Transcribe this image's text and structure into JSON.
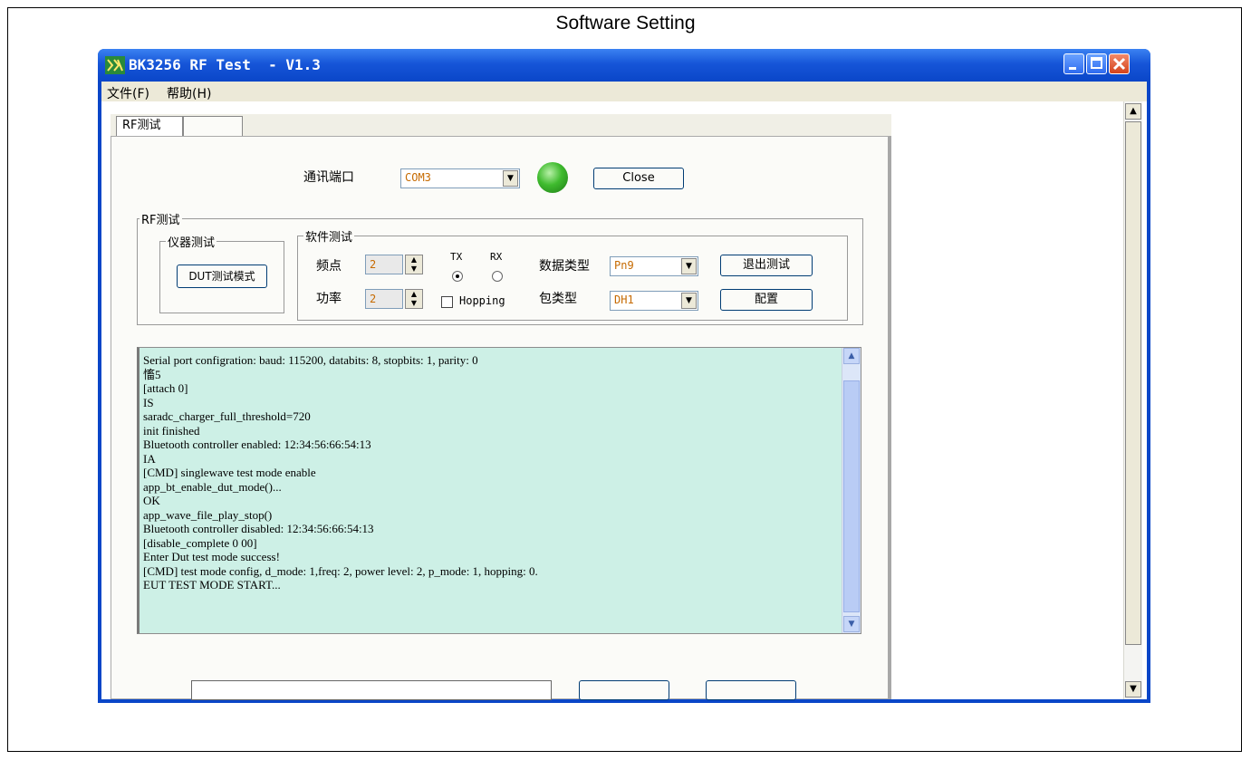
{
  "page": {
    "title": "Software Setting"
  },
  "window": {
    "title": "BK3256 RF Test  - V1.3",
    "menu": [
      "文件(F)",
      "帮助(H)"
    ]
  },
  "tabs": [
    {
      "label": "RF测试"
    },
    {
      "label": ""
    }
  ],
  "connection": {
    "port_label": "通讯端口",
    "port_value": "COM3",
    "status_color": "#3fbb2e",
    "close_label": "Close"
  },
  "rf_group": {
    "label": "RF测试",
    "instrument": {
      "label": "仪器测试",
      "dut_button": "DUT测试模式"
    },
    "software": {
      "label": "软件测试",
      "freq_label": "频点",
      "freq_value": "2",
      "power_label": "功率",
      "power_value": "2",
      "tx_label": "TX",
      "rx_label": "RX",
      "tx_selected": true,
      "hopping_label": "Hopping",
      "hopping_checked": false,
      "data_type_label": "数据类型",
      "data_type_value": "Pn9",
      "packet_type_label": "包类型",
      "packet_type_value": "DH1",
      "exit_button": "退出测试",
      "config_button": "配置"
    }
  },
  "log": {
    "lines": [
      "Serial port configration: baud: 115200, databits: 8, stopbits: 1, parity: 0",
      "慉5",
      "[attach 0]",
      "IS",
      "saradc_charger_full_threshold=720",
      "init finished",
      "Bluetooth controller enabled: 12:34:56:66:54:13",
      "IA",
      "[CMD] singlewave test mode enable",
      "app_bt_enable_dut_mode()...",
      "OK",
      "app_wave_file_play_stop()",
      "Bluetooth controller disabled: 12:34:56:66:54:13",
      "[disable_complete 0 00]",
      "Enter Dut test mode success!",
      "[CMD] test mode config, d_mode: 1,freq: 2, power level: 2, p_mode: 1, hopping: 0.",
      "EUT TEST MODE START..."
    ]
  }
}
